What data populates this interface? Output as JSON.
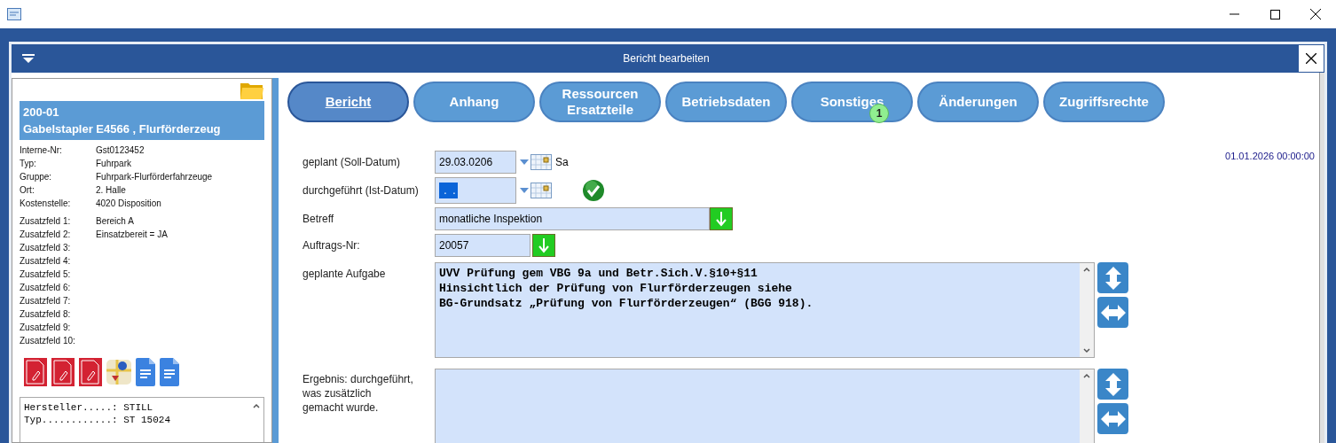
{
  "dialog": {
    "title": "Bericht bearbeiten"
  },
  "object": {
    "code": "200-01",
    "name": "Gabelstapler E4566 , Flurförderzeug",
    "fields": [
      {
        "label": "Interne-Nr:",
        "value": "Gst0123452"
      },
      {
        "label": "Typ:",
        "value": "Fuhrpark"
      },
      {
        "label": "Gruppe:",
        "value": "Fuhrpark-Flurförderfahrzeuge"
      },
      {
        "label": "Ort:",
        "value": "2. Halle"
      },
      {
        "label": "Kostenstelle:",
        "value": "4020 Disposition"
      }
    ],
    "extra_fields": [
      {
        "label": "Zusatzfeld 1:",
        "value": "Bereich A"
      },
      {
        "label": "Zusatzfeld 2:",
        "value": "Einsatzbereit = JA"
      },
      {
        "label": "Zusatzfeld 3:"
      },
      {
        "label": "Zusatzfeld 4:"
      },
      {
        "label": "Zusatzfeld 5:"
      },
      {
        "label": "Zusatzfeld 6:"
      },
      {
        "label": "Zusatzfeld 7:"
      },
      {
        "label": "Zusatzfeld 8:"
      },
      {
        "label": "Zusatzfeld 9:"
      },
      {
        "label": "Zusatzfeld 10:"
      }
    ],
    "attachments": [
      {
        "kind": "pdf"
      },
      {
        "kind": "pdf"
      },
      {
        "kind": "pdf"
      },
      {
        "kind": "map"
      },
      {
        "kind": "doc"
      },
      {
        "kind": "doc"
      }
    ],
    "notes": [
      "Hersteller.....: STILL",
      "Typ............: ST 15024"
    ]
  },
  "tabs": [
    {
      "label": "Bericht",
      "selected": true
    },
    {
      "label": "Anhang",
      "selected": false
    },
    {
      "label": "Ressourcen\nErsatzteile",
      "selected": false
    },
    {
      "label": "Betriebsdaten",
      "selected": false
    },
    {
      "label": "Sonstiges",
      "selected": false,
      "badge": "1"
    },
    {
      "label": "Änderungen",
      "selected": false
    },
    {
      "label": "Zugriffsrechte",
      "selected": false
    }
  ],
  "timestamp": "01.01.2026 00:00:00",
  "form": {
    "planned_date": {
      "label": "geplant (Soll-Datum)",
      "value": "29.03.0206",
      "weekday": "Sa"
    },
    "done_date": {
      "label": "durchgeführt (Ist-Datum)",
      "value": " .  .",
      "done": true
    },
    "subject": {
      "label": "Betreff",
      "value": "monatliche Inspektion"
    },
    "order_no": {
      "label": "Auftrags-Nr:",
      "value": "20057"
    },
    "task": {
      "label": "geplante Aufgabe",
      "value": "UVV Prüfung gem VBG 9a und Betr.Sich.V.§10+§11\nHinsichtlich der Prüfung von Flurförderzeugen siehe\nBG-Grundsatz „Prüfung von Flurförderzeugen“ (BGG 918)."
    },
    "result": {
      "label": "Ergebnis: durchgeführt,\nwas zusätzlich\ngemacht wurde."
    }
  }
}
